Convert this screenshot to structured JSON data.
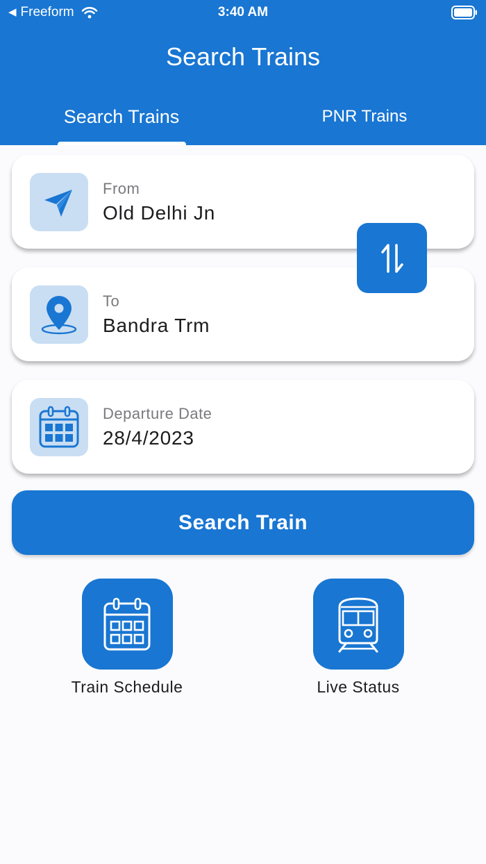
{
  "colors": {
    "primary": "#1976d2",
    "icon_bg": "#c9def3",
    "background": "#fbfbfd"
  },
  "status_bar": {
    "back_app": "Freeform",
    "time": "3:40 AM"
  },
  "header": {
    "title": "Search Trains"
  },
  "tabs": [
    {
      "label": "Search Trains",
      "selected": true
    },
    {
      "label": "PNR Trains",
      "selected": false
    }
  ],
  "form": {
    "from": {
      "label": "From",
      "value": "Old Delhi Jn",
      "icon": "paper-plane-icon"
    },
    "to": {
      "label": "To",
      "value": "Bandra Trm",
      "icon": "location-pin-icon"
    },
    "date": {
      "label": "Departure Date",
      "value": "28/4/2023",
      "icon": "calendar-icon"
    },
    "swap_icon": "swap-arrows-icon",
    "search_label": "Search Train"
  },
  "quick_actions": [
    {
      "label": "Train Schedule",
      "icon": "calendar-grid-icon"
    },
    {
      "label": "Live Status",
      "icon": "train-icon"
    }
  ]
}
